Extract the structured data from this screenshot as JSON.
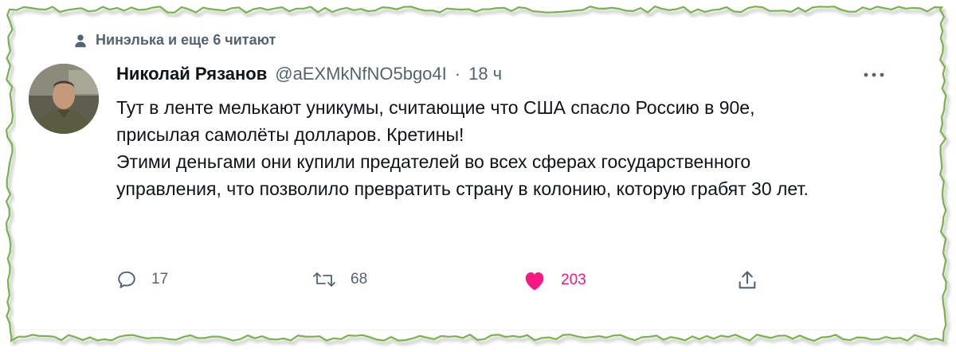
{
  "social_context": {
    "icon": "person-icon",
    "text": "Нинэлька и еще 6 читают"
  },
  "tweet": {
    "author_name": "Николай Рязанов",
    "handle": "@aEXMkNfNO5bgo4I",
    "separator": "·",
    "time": "18 ч",
    "more_icon": "more-horizontal-icon",
    "text_lines": [
      "Тут в ленте мелькают уникумы, считающие что США спасло Россию в 90е, присылая самолёты долларов. Кретины!",
      "Этими деньгами они купили предателей во всех сферах государственного управления, что позволило превратить страну в колонию, которую грабят 30 лет."
    ],
    "actions": {
      "reply": {
        "icon": "reply-icon",
        "count": "17"
      },
      "retweet": {
        "icon": "retweet-icon",
        "count": "68"
      },
      "like": {
        "icon": "heart-filled-icon",
        "count": "203",
        "color": "#f91880"
      },
      "share": {
        "icon": "share-icon"
      }
    }
  },
  "colors": {
    "text_primary": "#0f1419",
    "text_secondary": "#536471",
    "like": "#f91880",
    "frame_border": "#78b44a"
  }
}
